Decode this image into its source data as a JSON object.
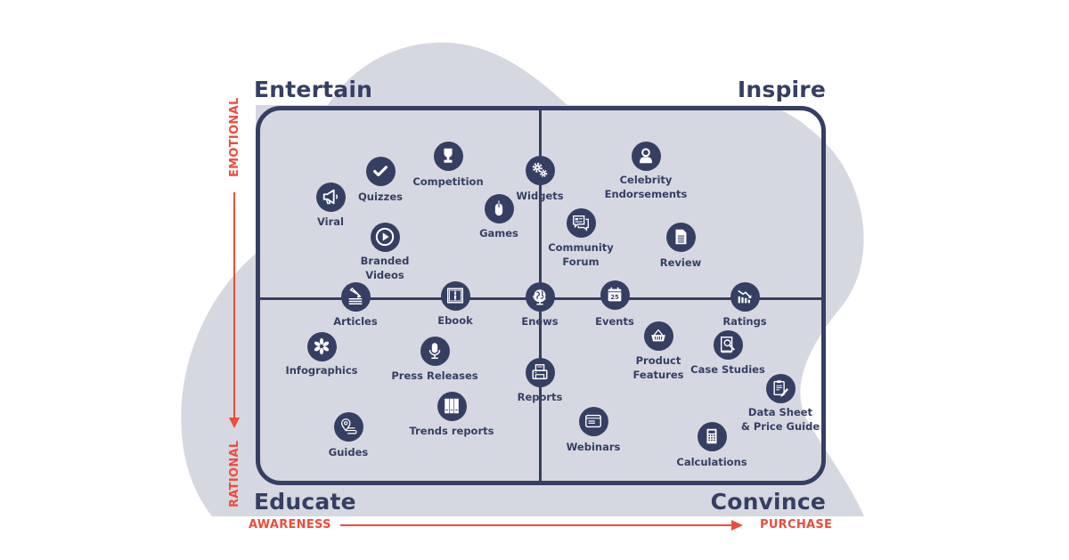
{
  "colors": {
    "navy": "#353f63",
    "accent": "#ef4b3a",
    "blob": "#d5d8e0"
  },
  "quadrants": {
    "top_left": "Entertain",
    "top_right": "Inspire",
    "bottom_left": "Educate",
    "bottom_right": "Convince"
  },
  "axes": {
    "vertical_top": "EMOTIONAL",
    "vertical_bottom": "RATIONAL",
    "horizontal_left": "AWARENESS",
    "horizontal_right": "PURCHASE"
  },
  "items": [
    {
      "id": "viral",
      "label": "Viral",
      "icon": "megaphone-icon"
    },
    {
      "id": "quizzes",
      "label": "Quizzes",
      "icon": "checkmark-icon"
    },
    {
      "id": "competition",
      "label": "Competition",
      "icon": "trophy-icon"
    },
    {
      "id": "games",
      "label": "Games",
      "icon": "mouse-icon"
    },
    {
      "id": "widgets",
      "label": "Widgets",
      "icon": "gears-icon"
    },
    {
      "id": "branded-videos",
      "label": "Branded\nVideos",
      "icon": "play-icon"
    },
    {
      "id": "celebrity-endorsements",
      "label": "Celebrity\nEndorsements",
      "icon": "user-icon"
    },
    {
      "id": "community-forum",
      "label": "Community\nForum",
      "icon": "chat-bubbles-icon"
    },
    {
      "id": "review",
      "label": "Review",
      "icon": "document-icon"
    },
    {
      "id": "articles",
      "label": "Articles",
      "icon": "pencil-paper-icon"
    },
    {
      "id": "ebook",
      "label": "Ebook",
      "icon": "open-book-icon"
    },
    {
      "id": "enews",
      "label": "Enews",
      "icon": "globe-icon"
    },
    {
      "id": "events",
      "label": "Events",
      "icon": "calendar-icon",
      "icon_text": "25"
    },
    {
      "id": "ratings",
      "label": "Ratings",
      "icon": "bar-chart-down-icon"
    },
    {
      "id": "infographics",
      "label": "Infographics",
      "icon": "asterisk-icon"
    },
    {
      "id": "press-releases",
      "label": "Press Releases",
      "icon": "microphone-icon"
    },
    {
      "id": "reports",
      "label": "Reports",
      "icon": "printer-icon"
    },
    {
      "id": "product-features",
      "label": "Product\nFeatures",
      "icon": "basket-icon"
    },
    {
      "id": "case-studies",
      "label": "Case Studies",
      "icon": "book-magnifier-icon"
    },
    {
      "id": "data-sheet",
      "label": "Data Sheet\n& Price Guide",
      "icon": "clipboard-pen-icon"
    },
    {
      "id": "guides",
      "label": "Guides",
      "icon": "map-pin-icon"
    },
    {
      "id": "trends-reports",
      "label": "Trends reports",
      "icon": "binders-icon"
    },
    {
      "id": "webinars",
      "label": "Webinars",
      "icon": "browser-window-icon"
    },
    {
      "id": "calculations",
      "label": "Calculations",
      "icon": "calculator-icon"
    }
  ]
}
